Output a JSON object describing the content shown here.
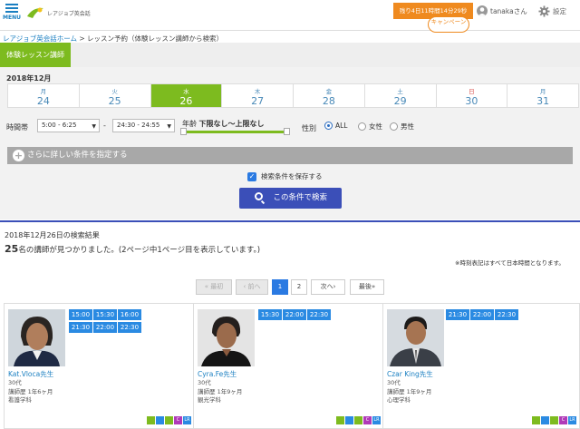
{
  "header": {
    "menu_label": "MENU",
    "logo_text": "レアジョブ英会話",
    "remaining": "残り4日11時間14分29秒",
    "campaign": "キャンペーン",
    "user_name": "tanakaさん",
    "settings": "設定",
    "colors": {
      "accent_orange": "#ef8a1f",
      "brand_blue": "#1a7fc1"
    }
  },
  "breadcrumb": {
    "home": "レアジョブ英会話ホーム",
    "sep": " > ",
    "current": "レッスン予約（体験レッスン講師から検索）"
  },
  "tab": {
    "active": "体験レッスン講師",
    "color": "#7dbb1f"
  },
  "filter": {
    "month": "2018年12月",
    "days": [
      {
        "dow": "月",
        "num": "24"
      },
      {
        "dow": "火",
        "num": "25"
      },
      {
        "dow": "水",
        "num": "26"
      },
      {
        "dow": "木",
        "num": "27"
      },
      {
        "dow": "金",
        "num": "28"
      },
      {
        "dow": "土",
        "num": "29"
      },
      {
        "dow": "日",
        "num": "30"
      },
      {
        "dow": "月",
        "num": "31"
      }
    ],
    "selected_day_index": 2,
    "time_label": "時間帯",
    "time_from": "5:00 - 6:25",
    "time_to": "24:30 - 24:55",
    "time_sep": "-",
    "age_label": "年齢",
    "age_value": "下限なし～上限なし",
    "sex_label": "性別",
    "sex_options": [
      "ALL",
      "女性",
      "男性"
    ],
    "sex_selected": "ALL",
    "more_conditions": "さらに詳しい条件を指定する",
    "save_conditions": "検索条件を保存する",
    "save_checked": true,
    "search_button": "この条件で検索"
  },
  "results": {
    "date_line": "2018年12月26日の検索結果",
    "count_number": "25",
    "count_text": "名の講師が見つかりました。(2ページ中1ページ目を表示しています。)",
    "tz_note": "※時刻表記はすべて日本時間となります。",
    "pagination": {
      "first": "« 最初",
      "prev": "‹ 前へ",
      "pages": [
        "1",
        "2"
      ],
      "current": "1",
      "next": "次へ›",
      "last": "最後»"
    },
    "tutors": [
      {
        "name": "Kat.Vloca先生",
        "age": "30代",
        "experience": "講師歴 1年6ヶ月",
        "major": "看護学科",
        "slots": [
          "15:00",
          "15:30",
          "16:00",
          "21:30",
          "22:00",
          "22:30"
        ]
      },
      {
        "name": "Cyra.Fe先生",
        "age": "30代",
        "experience": "講師歴 1年9ヶ月",
        "major": "観光学科",
        "slots": [
          "15:30",
          "22:00",
          "22:30"
        ]
      },
      {
        "name": "Czar King先生",
        "age": "30代",
        "experience": "講師歴 1年9ヶ月",
        "major": "心理学科",
        "slots": [
          "21:30",
          "22:00",
          "22:30"
        ]
      }
    ],
    "badges": [
      {
        "icon": "beginner-icon",
        "color": "#7dbb1f"
      },
      {
        "icon": "card-icon",
        "color": "#2a8ae2"
      },
      {
        "icon": "chat-icon",
        "color": "#7dbb1f"
      },
      {
        "icon": "c-icon",
        "color": "#b03ab8",
        "text": "C"
      },
      {
        "icon": "lr-icon",
        "color": "#2a8ae2",
        "text": "LR"
      }
    ]
  }
}
